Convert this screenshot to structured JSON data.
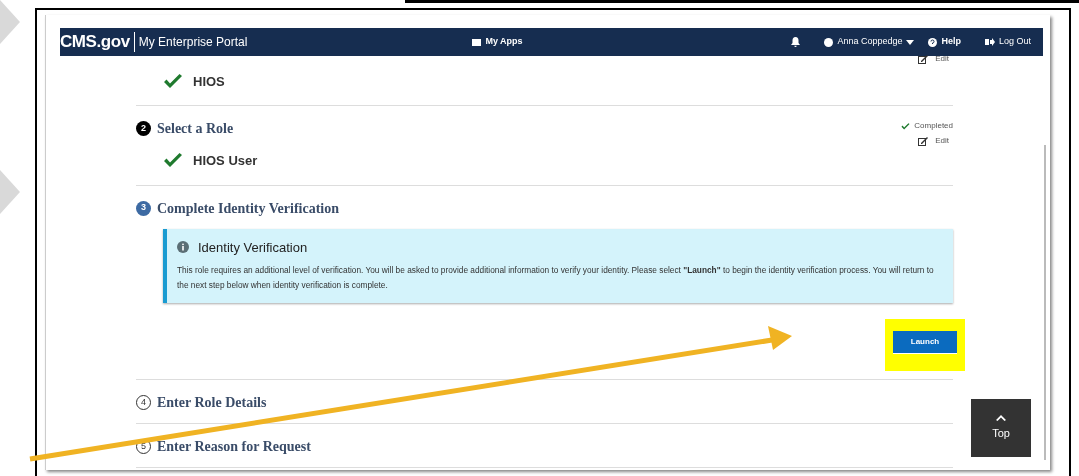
{
  "portal": {
    "brand": "CMS.gov",
    "title": "My Enterprise Portal",
    "apps": "My Apps",
    "user": "Anna Coppedge",
    "help": "Help",
    "logout": "Log Out"
  },
  "scrolled_step": {
    "edit": "Edit",
    "selection": "HIOS"
  },
  "steps": [
    {
      "number": "2",
      "title": "Select a Role",
      "kind": "done",
      "status": "Completed",
      "edit": "Edit",
      "selection": "HIOS User"
    },
    {
      "number": "3",
      "title": "Complete Identity Verification",
      "kind": "current",
      "alert": {
        "title": "Identity Verification",
        "text": "This role requires an additional level of verification. You will be asked to provide additional information to verify your identity. Please select **\"Launch\"** to begin the identity verification process. You will return to the next step below when identity verification is complete."
      },
      "button": {
        "label": "Launch",
        "highlighted": true
      }
    },
    {
      "number": "4",
      "title": "Enter Role Details",
      "kind": "pending"
    },
    {
      "number": "5",
      "title": "Enter Reason for Request",
      "kind": "pending"
    }
  ],
  "top_button": "Top"
}
